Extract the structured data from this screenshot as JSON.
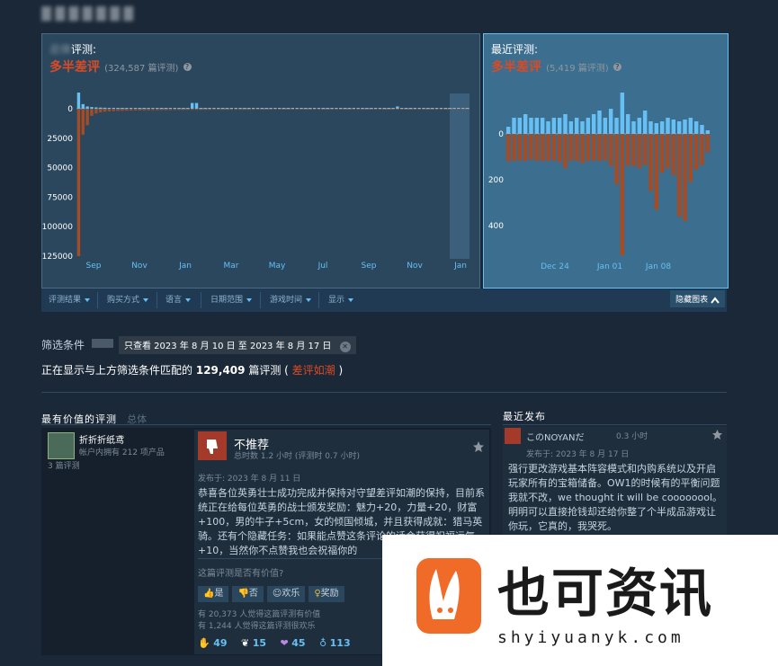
{
  "page": {
    "blurred_heading": "▓ ▓ ▓ ▓ ▓ ▓ ▓",
    "overall": {
      "title_prefix": "总体",
      "title": "评测:",
      "rating": "多半差评",
      "count": "(324,587 篇评测)",
      "help": "?"
    },
    "recent": {
      "title": "最近评测:",
      "rating": "多半差评",
      "count": "(5,419 篇评测)",
      "help": "?"
    },
    "filters": {
      "items": [
        {
          "label": "评测结果"
        },
        {
          "label": "购买方式"
        },
        {
          "label": "语言"
        },
        {
          "label": "日期范围"
        },
        {
          "label": "游戏时间"
        },
        {
          "label": "显示"
        }
      ],
      "hide_graph": "隐藏图表",
      "hide_icon": "chevron-up-icon"
    },
    "filter_conditions": {
      "label": "筛选条件",
      "active_filter": "只查看 2023 年 8 月 10 日 至 2023 年 8 月 17 日",
      "remove": "✕"
    },
    "summary": {
      "prefix": "正在显示与上方筛选条件匹配的",
      "count": "129,409",
      "suffix": "篇评测 (",
      "rating": "差评如潮",
      "close_paren": ")"
    },
    "most_helpful": {
      "title": "最有价值的评测",
      "subtitle": "总体",
      "review": {
        "author": "折折折纸鸢",
        "products": "帐户内拥有 212 项产品",
        "reviews": "3 篇评测",
        "verdict": "不推荐",
        "hours": "总时数 1.2 小时 (评测时 0.7 小时)",
        "posted": "发布于: 2023 年 8 月 11 日",
        "text": "恭喜各位英勇壮士成功完成并保持对守望差评如潮的保持，目前系统正在给每位英勇的战士颁发奖励：魅力+20，力量+20，财富+100，男的牛子+5cm，女的倾国倾城，并且获得成就：猎马英骑。还有个隐藏任务：如果能点赞这条评论的话会获得祝福运气+10，当然你不点赞我也会祝福你的",
        "helpful_q": "这篇评测是否有价值?",
        "btn_yes": "是",
        "btn_no": "否",
        "btn_funny": "欢乐",
        "btn_award": "奖励",
        "helpful_count": "有 20,373 人觉得这篇评测有价值",
        "funny_count": "有 1,244 人觉得这篇评测很欢乐",
        "awards": [
          {
            "icon": "hand-icon",
            "count": "49"
          },
          {
            "icon": "wings-icon",
            "count": "15"
          },
          {
            "icon": "heart-hands-icon",
            "count": "45"
          },
          {
            "icon": "medal-icon",
            "count": "113"
          }
        ]
      }
    },
    "recent_posts": {
      "title": "最近发布",
      "review": {
        "author": "このNOYANだ",
        "hours": "0.3 小时",
        "posted": "发布于: 2023 年 8 月 17 日",
        "text": "强行更改游戏基本阵容模式和内购系统以及开启玩家所有的宝箱储备。OW1的时候有的平衡问题我就不改，we thought it will be coooooool。明明可以直接抢钱却还给你整了个半成品游戏让你玩，它真的，我哭死。"
      }
    },
    "watermark": {
      "cn": "也可资讯",
      "en": "shyiyuanyk.com"
    },
    "colors": {
      "bg": "#1b2838",
      "positive": "#66c0f4",
      "negative": "#a34c25",
      "accent_red": "#d94b26"
    }
  },
  "chart_data": [
    {
      "type": "bar",
      "title": "",
      "xlabel": "",
      "ylabel": "",
      "x_ticks": [
        "Sep",
        "Nov",
        "Jan",
        "Mar",
        "May",
        "Jul",
        "Sep",
        "Nov",
        "Jan"
      ],
      "y_ticks": [
        "0",
        "25000",
        "50000",
        "75000",
        "100000",
        "125000"
      ],
      "ylim": [
        -10000,
        125000
      ],
      "series": [
        {
          "values_positive": [
            14000,
            4000,
            2000,
            1500,
            1200,
            1000,
            900,
            800,
            800,
            700,
            700,
            700,
            650,
            600,
            600,
            600,
            600,
            600,
            550,
            550,
            550,
            550,
            500,
            500,
            500,
            500,
            5000,
            5000,
            500,
            500,
            500,
            500,
            500,
            500,
            500,
            500,
            500,
            500,
            500,
            500,
            450,
            450,
            450,
            450,
            450,
            450,
            450,
            450,
            450,
            450,
            450,
            450,
            450,
            450,
            450,
            450,
            450,
            450,
            450,
            450,
            450,
            450,
            450,
            450,
            450,
            450,
            450,
            450,
            450,
            450,
            450,
            450,
            450,
            2000,
            450,
            450,
            450,
            450,
            450,
            450,
            450,
            450,
            450,
            450,
            450,
            450,
            450,
            450,
            450,
            450
          ]
        },
        {
          "values_negative": [
            125000,
            22000,
            14000,
            6000,
            4000,
            3000,
            2500,
            2200,
            2000,
            1900,
            1800,
            1700,
            1600,
            1500,
            1500,
            1400,
            1400,
            1300,
            1300,
            1200,
            1200,
            1200,
            1100,
            1100,
            1100,
            1000,
            1000,
            1000,
            1000,
            1000,
            1000,
            900,
            900,
            900,
            900,
            900,
            900,
            900,
            900,
            900,
            900,
            800,
            800,
            800,
            800,
            800,
            800,
            800,
            800,
            800,
            800,
            800,
            800,
            800,
            800,
            800,
            800,
            800,
            800,
            800,
            800,
            800,
            800,
            800,
            800,
            800,
            800,
            800,
            800,
            800,
            800,
            800,
            800,
            800,
            800,
            800,
            800,
            800,
            800,
            800,
            800,
            800,
            800,
            800,
            800,
            800,
            800,
            800,
            800,
            800
          ]
        }
      ]
    },
    {
      "type": "bar",
      "title": "",
      "xlabel": "",
      "ylabel": "",
      "x_ticks": [
        "Dec 24",
        "Jan 01",
        "Jan 08"
      ],
      "y_ticks": [
        "0",
        "200",
        "400"
      ],
      "ylim": [
        -20,
        520
      ],
      "series": [
        {
          "values_positive": [
            8,
            18,
            18,
            22,
            18,
            18,
            18,
            14,
            18,
            18,
            22,
            14,
            18,
            14,
            18,
            22,
            26,
            18,
            28,
            18,
            46,
            22,
            14,
            18,
            26,
            14,
            12,
            14,
            18,
            16,
            14,
            16,
            18,
            14,
            10,
            4
          ]
        },
        {
          "values_negative": [
            120,
            118,
            116,
            118,
            112,
            118,
            118,
            118,
            116,
            124,
            150,
            118,
            118,
            128,
            118,
            116,
            118,
            116,
            140,
            220,
            530,
            140,
            140,
            150,
            136,
            250,
            330,
            170,
            150,
            180,
            360,
            380,
            210,
            156,
            136,
            80
          ]
        }
      ]
    }
  ]
}
